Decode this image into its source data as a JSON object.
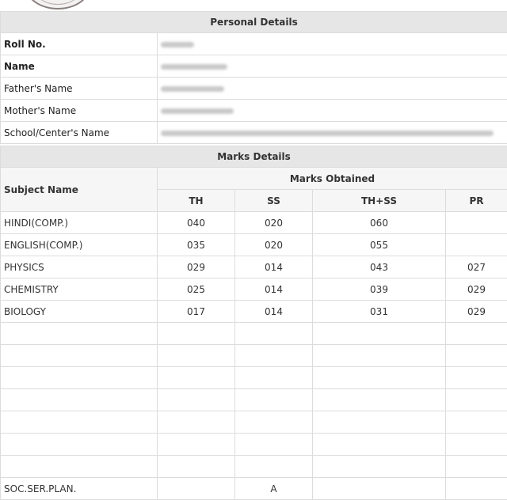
{
  "personal": {
    "title": "Personal Details",
    "rows": [
      {
        "label": "Roll No.",
        "bold": true
      },
      {
        "label": "Name",
        "bold": true
      },
      {
        "label": "Father's Name",
        "bold": false
      },
      {
        "label": "Mother's Name",
        "bold": false
      },
      {
        "label": "School/Center's Name",
        "bold": false
      }
    ]
  },
  "marks": {
    "title": "Marks Details",
    "subject_header": "Subject Name",
    "obtained_header": "Marks Obtained",
    "columns": [
      "TH",
      "SS",
      "TH+SS",
      "PR"
    ],
    "subjects": [
      {
        "name": "HINDI(COMP.)",
        "th": "040",
        "ss": "020",
        "thss": "060",
        "pr": ""
      },
      {
        "name": "ENGLISH(COMP.)",
        "th": "035",
        "ss": "020",
        "thss": "055",
        "pr": ""
      },
      {
        "name": "PHYSICS",
        "th": "029",
        "ss": "014",
        "thss": "043",
        "pr": "027"
      },
      {
        "name": "CHEMISTRY",
        "th": "025",
        "ss": "014",
        "thss": "039",
        "pr": "029"
      },
      {
        "name": "BIOLOGY",
        "th": "017",
        "ss": "014",
        "thss": "031",
        "pr": "029"
      }
    ],
    "extra": {
      "name": "SOC.SER.PLAN.",
      "th": "",
      "ss": "A",
      "thss": "",
      "pr": ""
    }
  }
}
